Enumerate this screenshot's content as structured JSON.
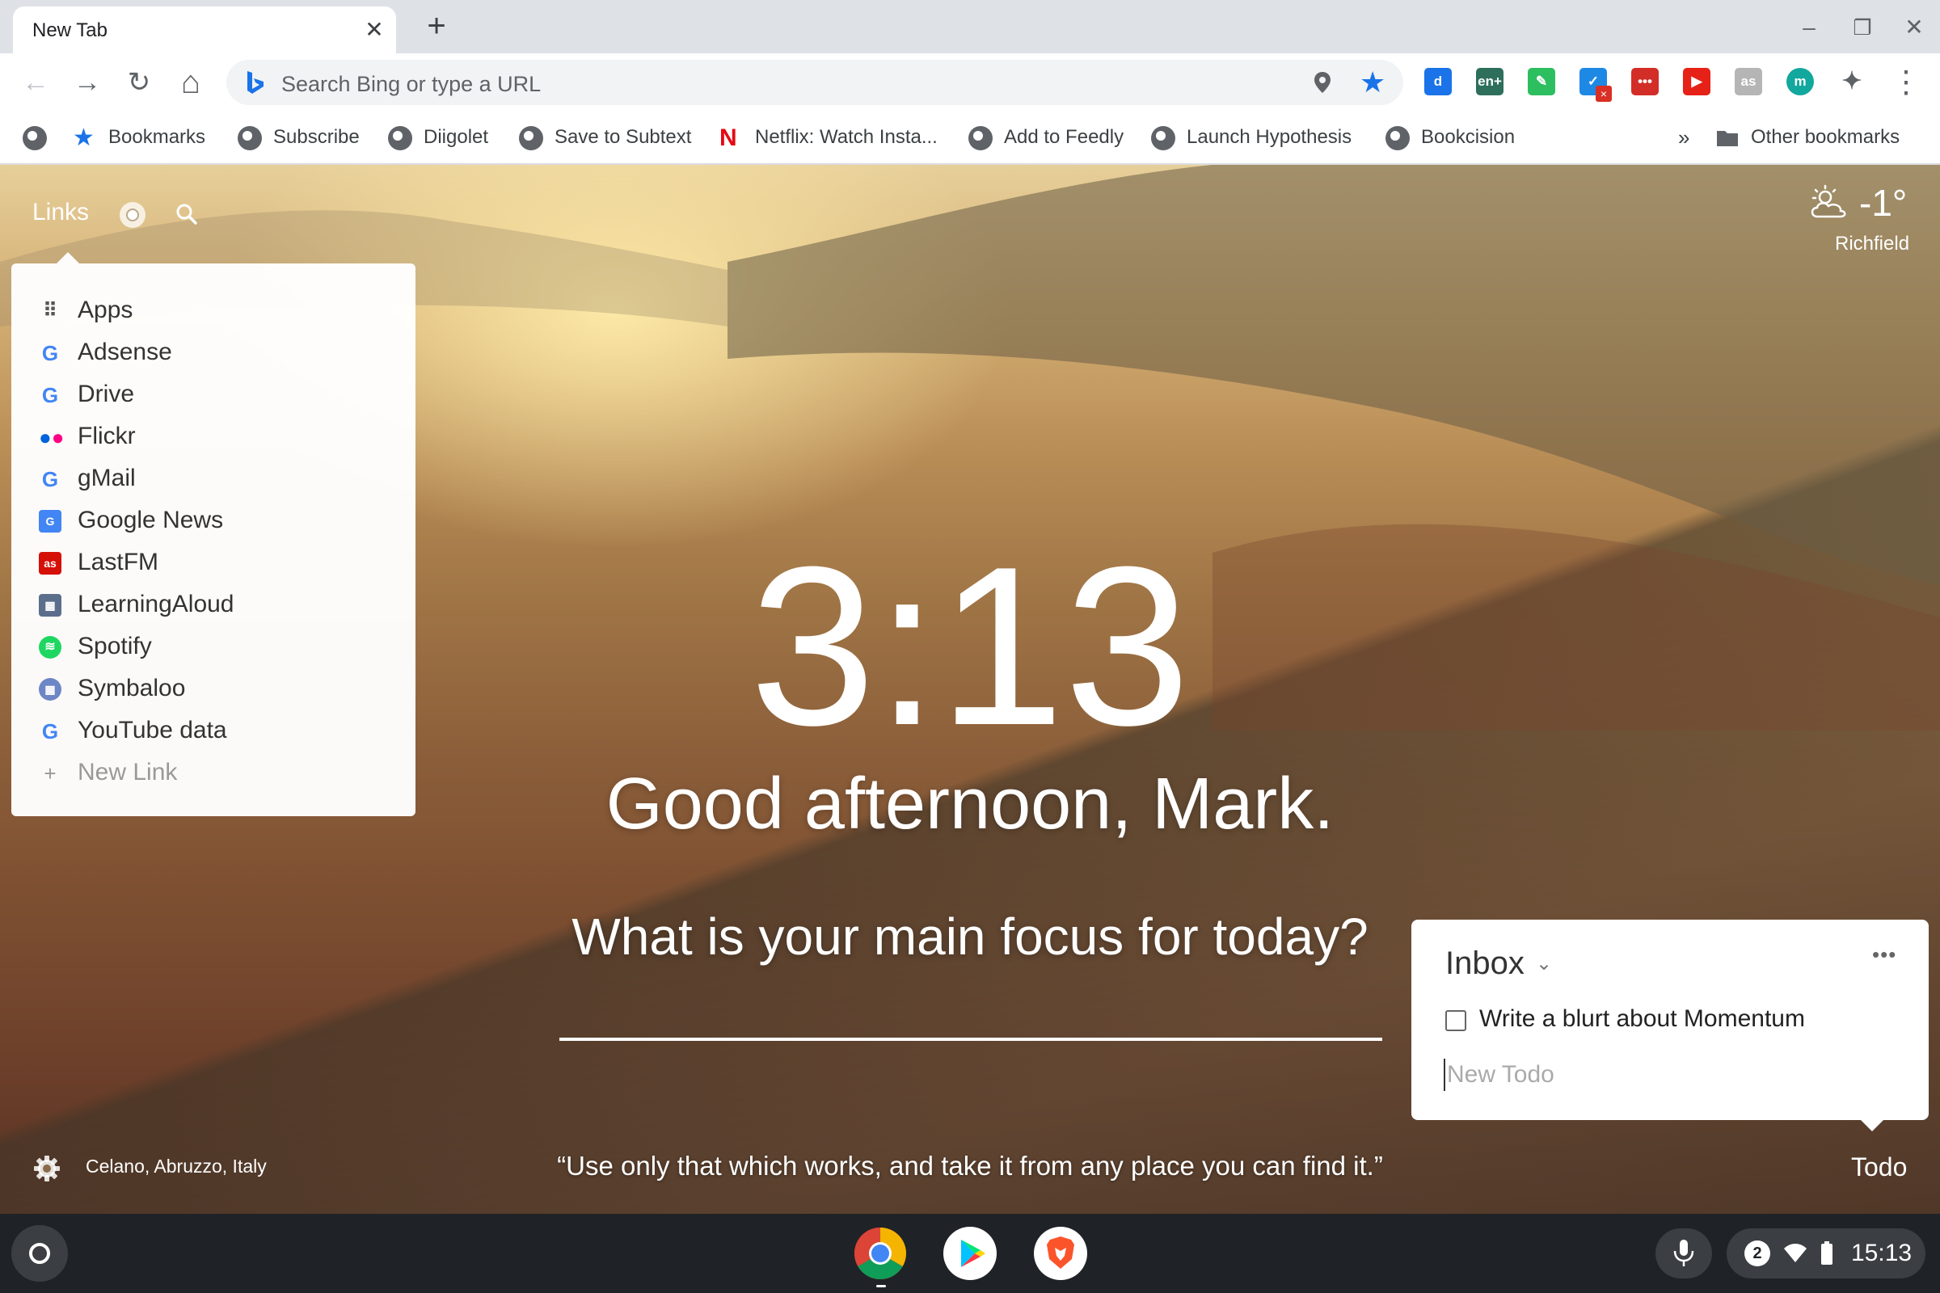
{
  "tab": {
    "title": "New Tab",
    "close": "✕",
    "new_tab": "+"
  },
  "window_controls": {
    "minimize": "–",
    "maximize": "❐",
    "close": "✕"
  },
  "toolbar": {
    "back": "←",
    "forward": "→",
    "reload": "↻",
    "home": "⌂",
    "omnibox_placeholder": "Search Bing or type a URL",
    "bookmark_star": "★",
    "extensions": [
      {
        "name": "diigo",
        "label": "d",
        "color": "#1a73e8"
      },
      {
        "name": "en-plus",
        "label": "en+",
        "color": "#2d6f5a"
      },
      {
        "name": "evernote",
        "label": "✎",
        "color": "#2dbe60"
      },
      {
        "name": "todo-check",
        "label": "✓",
        "color": "#1e88e5"
      },
      {
        "name": "lastpass",
        "label": "•••",
        "color": "#d32d27"
      },
      {
        "name": "youtube-ext",
        "label": "▶",
        "color": "#e62117"
      },
      {
        "name": "lastfm-ext",
        "label": "as",
        "color": "#b5b5b5"
      },
      {
        "name": "momentum",
        "label": "m",
        "color": "#12a89d"
      },
      {
        "name": "puzzle",
        "label": "✦",
        "color": "#5f6368"
      }
    ],
    "menu": "⋮"
  },
  "bookmarks": {
    "items": [
      {
        "label": "Bookmarks",
        "icon": "star-icon"
      },
      {
        "label": "Subscribe",
        "icon": "globe-icon"
      },
      {
        "label": "Diigolet",
        "icon": "globe-icon"
      },
      {
        "label": "Save to Subtext",
        "icon": "globe-icon"
      },
      {
        "label": "Netflix: Watch Insta...",
        "icon": "netflix-icon"
      },
      {
        "label": "Add to Feedly",
        "icon": "globe-icon"
      },
      {
        "label": "Launch Hypothesis",
        "icon": "globe-icon"
      },
      {
        "label": "Bookcision",
        "icon": "globe-icon"
      }
    ],
    "overflow": "»",
    "other": "Other bookmarks"
  },
  "links": {
    "label": "Links",
    "items": [
      {
        "label": "Apps"
      },
      {
        "label": "Adsense"
      },
      {
        "label": "Drive"
      },
      {
        "label": "Flickr"
      },
      {
        "label": "gMail"
      },
      {
        "label": "Google News"
      },
      {
        "label": "LastFM"
      },
      {
        "label": "LearningAloud"
      },
      {
        "label": "Spotify"
      },
      {
        "label": "Symbaloo"
      },
      {
        "label": "YouTube data"
      }
    ],
    "new_link": "New Link"
  },
  "weather": {
    "temp": "-1°",
    "location": "Richfield"
  },
  "dashboard": {
    "time": "3:13",
    "greeting": "Good afternoon, Mark.",
    "focus_question": "What is your main focus for today?",
    "quote": "“Use only that which works, and take it from any place you can find it.”",
    "photo_location": "Celano, Abruzzo, Italy"
  },
  "todo": {
    "list_name": "Inbox",
    "more": "•••",
    "items": [
      {
        "text": "Write a blurt about Momentum",
        "done": false
      }
    ],
    "new_placeholder": "New Todo",
    "button_label": "Todo"
  },
  "shelf": {
    "notification_count": "2",
    "time": "15:13"
  }
}
